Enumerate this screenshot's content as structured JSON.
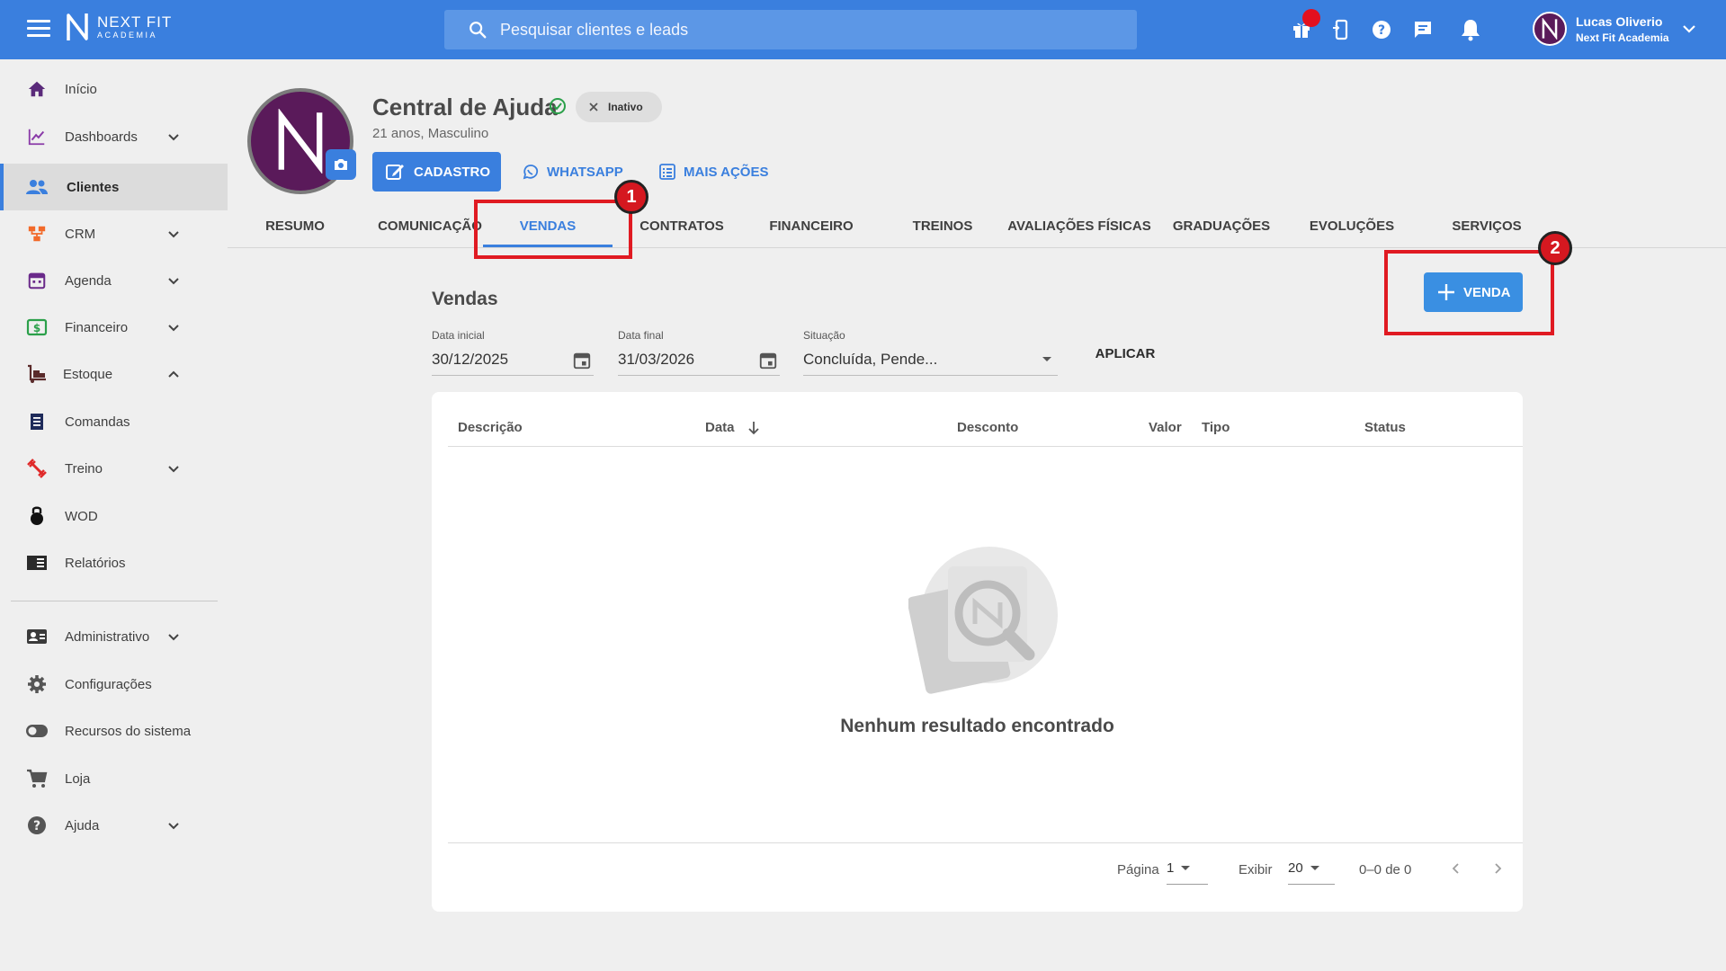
{
  "header": {
    "brand_name": "NEXT FIT",
    "brand_sub": "ACADEMIA",
    "search_placeholder": "Pesquisar clientes e leads",
    "user_name": "Lucas Oliverio",
    "user_org": "Next Fit Academia"
  },
  "sidebar": {
    "items": [
      {
        "label": "Início",
        "icon": "home-icon"
      },
      {
        "label": "Dashboards",
        "icon": "chart-line-icon"
      },
      {
        "label": "Clientes",
        "icon": "people-icon"
      },
      {
        "label": "CRM",
        "icon": "crm-icon"
      },
      {
        "label": "Agenda",
        "icon": "calendar-icon"
      },
      {
        "label": "Financeiro",
        "icon": "money-icon"
      },
      {
        "label": "Estoque",
        "icon": "dolly-icon"
      },
      {
        "label": "Comandas",
        "icon": "receipt-icon"
      },
      {
        "label": "Treino",
        "icon": "dumbbell-icon"
      },
      {
        "label": "WOD",
        "icon": "kettlebell-icon"
      },
      {
        "label": "Relatórios",
        "icon": "report-icon"
      },
      {
        "label": "Administrativo",
        "icon": "id-card-icon"
      },
      {
        "label": "Configurações",
        "icon": "gear-icon"
      },
      {
        "label": "Recursos do sistema",
        "icon": "toggle-icon"
      },
      {
        "label": "Loja",
        "icon": "cart-icon"
      },
      {
        "label": "Ajuda",
        "icon": "help-icon"
      }
    ]
  },
  "profile": {
    "name": "Central de Ajuda",
    "status": "Inativo",
    "subtitle": "21 anos, Masculino",
    "cadastro_label": "CADASTRO",
    "whatsapp_label": "WHATSAPP",
    "mais_acoes_label": "MAIS AÇÕES"
  },
  "tabs": [
    "RESUMO",
    "COMUNICAÇÃO",
    "VENDAS",
    "CONTRATOS",
    "FINANCEIRO",
    "TREINOS",
    "AVALIAÇÕES FÍSICAS",
    "GRADUAÇÕES",
    "EVOLUÇÕES",
    "SERVIÇOS"
  ],
  "active_tab": "VENDAS",
  "annotations": [
    "1",
    "2"
  ],
  "vendas": {
    "title": "Vendas",
    "new_button": "VENDA",
    "filters": {
      "data_inicial_label": "Data inicial",
      "data_inicial_value": "30/12/2025",
      "data_final_label": "Data final",
      "data_final_value": "31/03/2026",
      "situacao_label": "Situação",
      "situacao_value": "Concluída, Pende...",
      "apply_label": "APLICAR"
    },
    "table": {
      "columns": [
        "Descrição",
        "Data",
        "Desconto",
        "Valor",
        "Tipo",
        "Status"
      ],
      "rows": [],
      "empty_message": "Nenhum resultado encontrado"
    },
    "pagination": {
      "page_label": "Página",
      "page_value": "1",
      "show_label": "Exibir",
      "show_value": "20",
      "range_text": "0–0 de 0"
    }
  },
  "colors": {
    "primary": "#3a7fde",
    "annotation": "#e01a22",
    "brand_purple": "#5a1a5a"
  }
}
